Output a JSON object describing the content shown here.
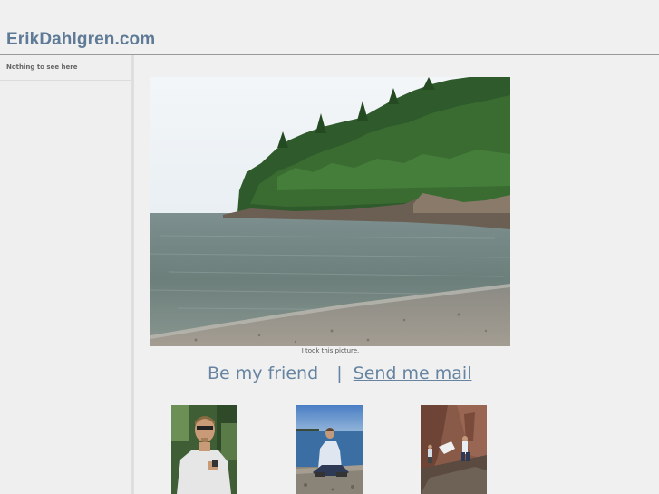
{
  "header": {
    "site_title": "ErikDahlgren.com"
  },
  "sidebar": {
    "heading": "Nothing to see here"
  },
  "main": {
    "photo_caption": "I took this picture.",
    "links": {
      "friend_label": "Be my friend",
      "separator": "|",
      "mail_label": "Send me mail"
    }
  },
  "colors": {
    "title": "#5e7a96",
    "link": "#6684a1",
    "background": "#f0f0f0"
  }
}
